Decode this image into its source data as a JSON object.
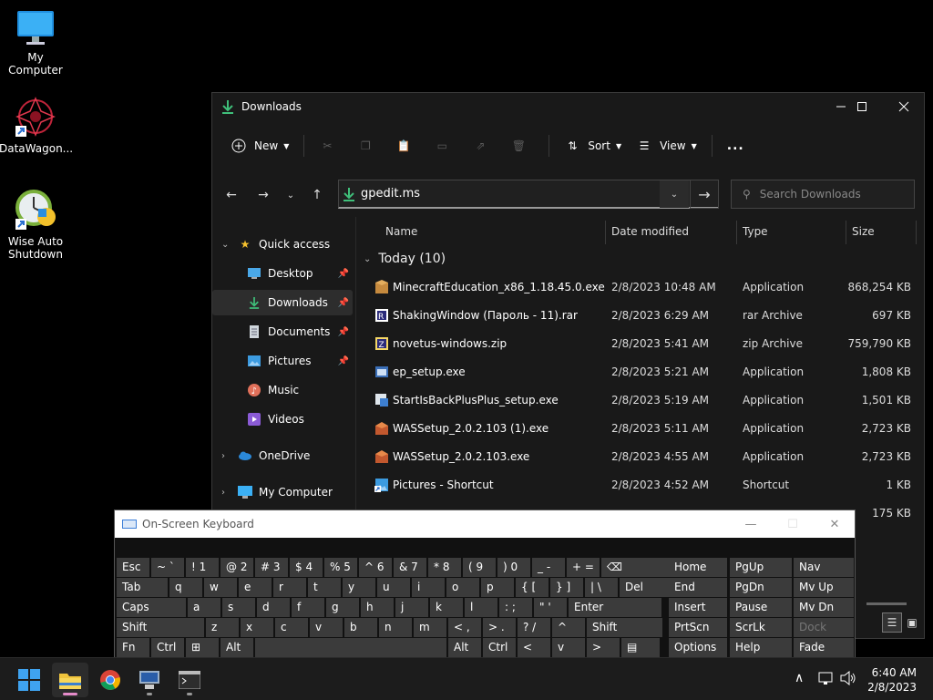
{
  "desktop": {
    "icons": [
      {
        "label": "My Computer",
        "icon": "monitor-icon"
      },
      {
        "label": "DataWagon...",
        "icon": "datawagon-icon"
      },
      {
        "label": "Wise Auto Shutdown",
        "icon": "clock-shutdown-icon"
      }
    ]
  },
  "explorer": {
    "title": "Downloads",
    "commands": {
      "new": "New",
      "sort": "Sort",
      "view": "View",
      "more": "..."
    },
    "address": "gpedit.ms",
    "search_placeholder": "Search Downloads",
    "sidebar": {
      "quick_access": "Quick access",
      "items": [
        {
          "label": "Desktop",
          "icon": "desktop-folder-icon",
          "pinned": true
        },
        {
          "label": "Downloads",
          "icon": "download-icon",
          "pinned": true,
          "selected": true
        },
        {
          "label": "Documents",
          "icon": "documents-icon",
          "pinned": true
        },
        {
          "label": "Pictures",
          "icon": "pictures-icon",
          "pinned": true
        },
        {
          "label": "Music",
          "icon": "music-icon",
          "pinned": false
        },
        {
          "label": "Videos",
          "icon": "videos-icon",
          "pinned": false
        }
      ],
      "onedrive": "OneDrive",
      "my_computer": "My Computer"
    },
    "columns": {
      "name": "Name",
      "date": "Date modified",
      "type": "Type",
      "size": "Size"
    },
    "group": "Today (10)",
    "files": [
      {
        "name": "MinecraftEducation_x86_1.18.45.0.exe",
        "date": "2/8/2023 10:48 AM",
        "type": "Application",
        "size": "868,254 KB"
      },
      {
        "name": "ShakingWindow (Пароль - 11).rar",
        "date": "2/8/2023 6:29 AM",
        "type": "rar Archive",
        "size": "697 KB"
      },
      {
        "name": "novetus-windows.zip",
        "date": "2/8/2023 5:41 AM",
        "type": "zip Archive",
        "size": "759,790 KB"
      },
      {
        "name": "ep_setup.exe",
        "date": "2/8/2023 5:21 AM",
        "type": "Application",
        "size": "1,808 KB"
      },
      {
        "name": "StartIsBackPlusPlus_setup.exe",
        "date": "2/8/2023 5:19 AM",
        "type": "Application",
        "size": "1,501 KB"
      },
      {
        "name": "WASSetup_2.0.2.103 (1).exe",
        "date": "2/8/2023 5:11 AM",
        "type": "Application",
        "size": "2,723 KB"
      },
      {
        "name": "WASSetup_2.0.2.103.exe",
        "date": "2/8/2023 4:55 AM",
        "type": "Application",
        "size": "2,723 KB"
      },
      {
        "name": "Pictures - Shortcut",
        "date": "2/8/2023 4:52 AM",
        "type": "Shortcut",
        "size": "1 KB"
      }
    ],
    "partial_file_size": "175 KB"
  },
  "osk": {
    "title": "On-Screen Keyboard",
    "row1": [
      "Esc",
      "~ `",
      "! 1",
      "@ 2",
      "# 3",
      "$ 4",
      "% 5",
      "^ 6",
      "& 7",
      "* 8",
      "( 9",
      ") 0",
      "_ -",
      "+ =",
      "⌫"
    ],
    "row2": [
      "Tab",
      "q",
      "w",
      "e",
      "r",
      "t",
      "y",
      "u",
      "i",
      "o",
      "p",
      "{ [",
      "} ]",
      "| \\",
      "Del"
    ],
    "row3": [
      "Caps",
      "a",
      "s",
      "d",
      "f",
      "g",
      "h",
      "j",
      "k",
      "l",
      ": ;",
      "\" '",
      "Enter"
    ],
    "row4": [
      "Shift",
      "z",
      "x",
      "c",
      "v",
      "b",
      "n",
      "m",
      "< ,",
      "> .",
      "? /",
      "^",
      "Shift"
    ],
    "row5": [
      "Fn",
      "Ctrl",
      "⊞",
      "Alt",
      "",
      "Alt",
      "Ctrl",
      "<",
      "v",
      ">",
      "▤"
    ],
    "nav": [
      [
        "Home",
        "PgUp",
        "Nav"
      ],
      [
        "End",
        "PgDn",
        "Mv Up"
      ],
      [
        "Insert",
        "Pause",
        "Mv Dn"
      ],
      [
        "PrtScn",
        "ScrLk",
        "Dock"
      ],
      [
        "Options",
        "Help",
        "Fade"
      ]
    ]
  },
  "taskbar": {
    "time": "6:40 AM",
    "date": "2/8/2023"
  }
}
